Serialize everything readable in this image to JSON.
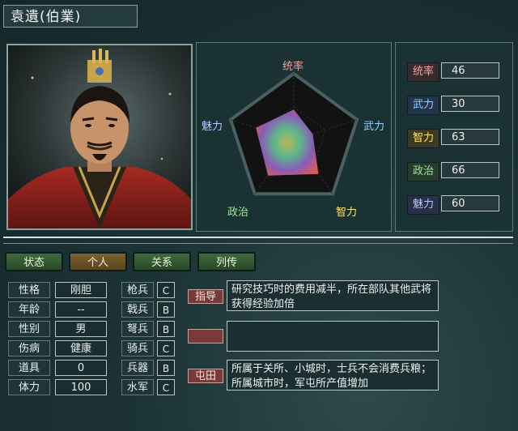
{
  "officer": {
    "name": "袁遺(伯業)"
  },
  "radar": {
    "labels": {
      "top": "统率",
      "right": "武力",
      "bottom_right": "智力",
      "bottom_left": "政治",
      "left": "魅力"
    },
    "max": 100
  },
  "stats": [
    {
      "label": "统率",
      "value": "46",
      "color": "#f1a0a0",
      "bg": "#3a2a2e"
    },
    {
      "label": "武力",
      "value": "30",
      "color": "#8fd0ff",
      "bg": "#23354a"
    },
    {
      "label": "智力",
      "value": "63",
      "color": "#ffe56a",
      "bg": "#3c3a22"
    },
    {
      "label": "政治",
      "value": "66",
      "color": "#9ee89e",
      "bg": "#253c2c"
    },
    {
      "label": "魅力",
      "value": "60",
      "color": "#b8c8ff",
      "bg": "#2a2f48"
    }
  ],
  "tabs": [
    {
      "label": "状态",
      "active": false
    },
    {
      "label": "个人",
      "active": true
    },
    {
      "label": "关系",
      "active": false
    },
    {
      "label": "列传",
      "active": false
    }
  ],
  "personal": [
    {
      "label": "性格",
      "value": "刚胆"
    },
    {
      "label": "年龄",
      "value": "--"
    },
    {
      "label": "性别",
      "value": "男"
    },
    {
      "label": "伤病",
      "value": "健康"
    },
    {
      "label": "道具",
      "value": "0"
    },
    {
      "label": "体力",
      "value": "100"
    }
  ],
  "aptitudes": [
    {
      "label": "枪兵",
      "value": "C"
    },
    {
      "label": "戟兵",
      "value": "B"
    },
    {
      "label": "弩兵",
      "value": "B"
    },
    {
      "label": "骑兵",
      "value": "C"
    },
    {
      "label": "兵器",
      "value": "B"
    },
    {
      "label": "水军",
      "value": "C"
    }
  ],
  "specialties": [
    {
      "tag": "指导",
      "desc": "研究技巧时的费用减半，所在部队其他武将获得经验加倍"
    },
    {
      "tag": "",
      "desc": ""
    },
    {
      "tag": "屯田",
      "desc": "所属于关所、小城时，士兵不会消费兵粮；所属城市时，军屯所产值增加"
    }
  ]
}
